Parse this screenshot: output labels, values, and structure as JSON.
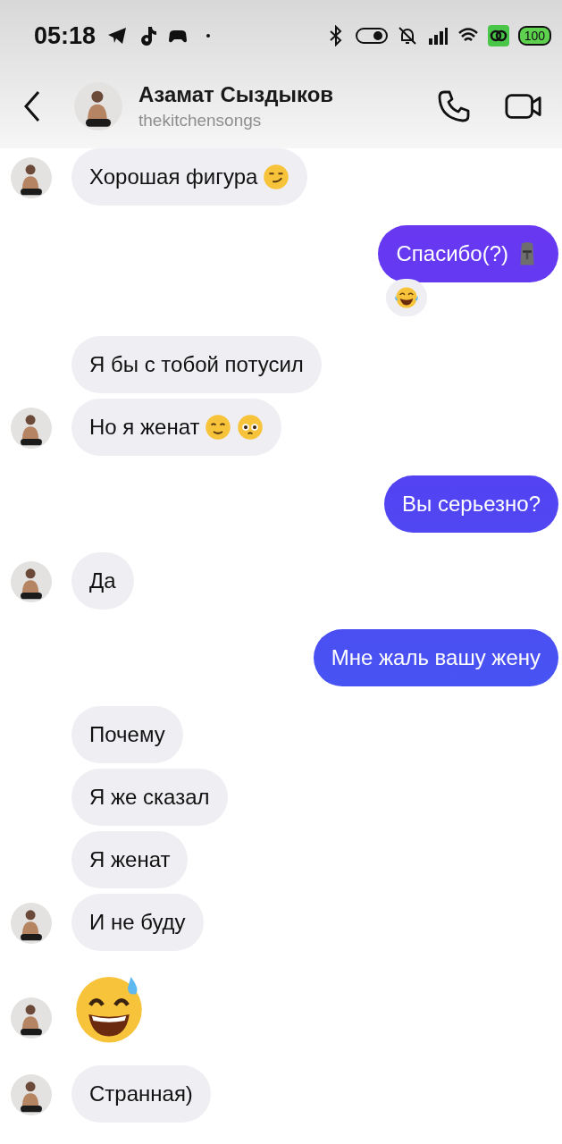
{
  "status_bar": {
    "time": "05:18",
    "battery": "100"
  },
  "header": {
    "name": "Азамат Сыздыков",
    "username": "thekitchensongs"
  },
  "messages": [
    {
      "outgoing": false,
      "avatar": true,
      "kind": "text",
      "text": "Хорошая фигура",
      "emojis": [
        {
          "kind": "smirk"
        }
      ]
    },
    {
      "outgoing": true,
      "avatar": false,
      "kind": "text",
      "text": "Спасибо(?)",
      "emojis": [
        {
          "kind": "moai"
        }
      ],
      "reaction": {
        "kind": "laugh"
      }
    },
    {
      "outgoing": false,
      "avatar": false,
      "kind": "text",
      "text": "Я бы с тобой потусил"
    },
    {
      "outgoing": false,
      "avatar": true,
      "kind": "text",
      "text": "Но я женат",
      "emojis": [
        {
          "kind": "blush"
        },
        {
          "kind": "pleading"
        }
      ]
    },
    {
      "outgoing": true,
      "avatar": false,
      "kind": "text",
      "text": "Вы серьезно?"
    },
    {
      "outgoing": false,
      "avatar": true,
      "kind": "text",
      "text": "Да"
    },
    {
      "outgoing": true,
      "avatar": false,
      "kind": "text",
      "text": "Мне жаль вашу жену"
    },
    {
      "outgoing": false,
      "avatar": false,
      "kind": "text",
      "text": "Почему"
    },
    {
      "outgoing": false,
      "avatar": false,
      "kind": "text",
      "text": "Я же сказал"
    },
    {
      "outgoing": false,
      "avatar": false,
      "kind": "text",
      "text": "Я женат"
    },
    {
      "outgoing": false,
      "avatar": true,
      "kind": "text",
      "text": "И не буду"
    },
    {
      "outgoing": false,
      "avatar": true,
      "kind": "emoji",
      "emojis": [
        {
          "kind": "sweat"
        }
      ]
    },
    {
      "outgoing": false,
      "avatar": true,
      "kind": "text",
      "text": "Странная)"
    }
  ]
}
